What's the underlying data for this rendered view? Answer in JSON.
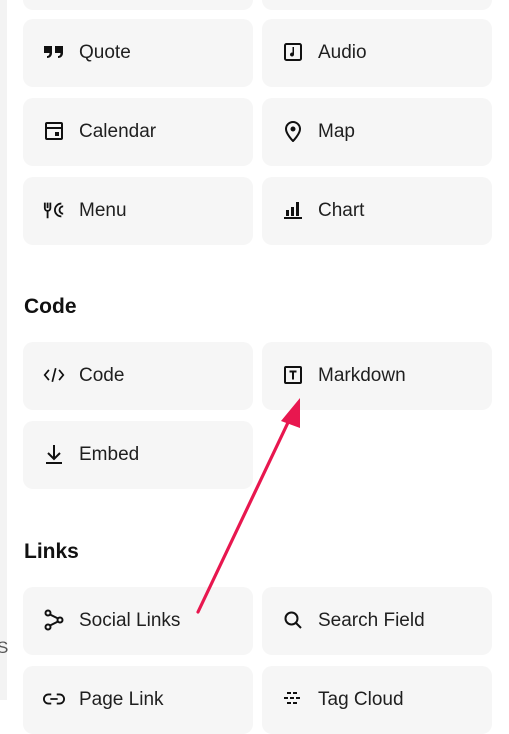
{
  "tiles_top": {
    "quote": "Quote",
    "audio": "Audio",
    "calendar": "Calendar",
    "map": "Map",
    "menu": "Menu",
    "chart": "Chart"
  },
  "sections": {
    "code": {
      "heading": "Code",
      "items": {
        "code": "Code",
        "markdown": "Markdown",
        "embed": "Embed"
      }
    },
    "links": {
      "heading": "Links",
      "items": {
        "social": "Social Links",
        "search": "Search Field",
        "page": "Page Link",
        "tag": "Tag Cloud"
      }
    }
  },
  "stray_text": "S",
  "colors": {
    "tile_bg": "#f6f6f6",
    "arrow": "#e8174f"
  }
}
